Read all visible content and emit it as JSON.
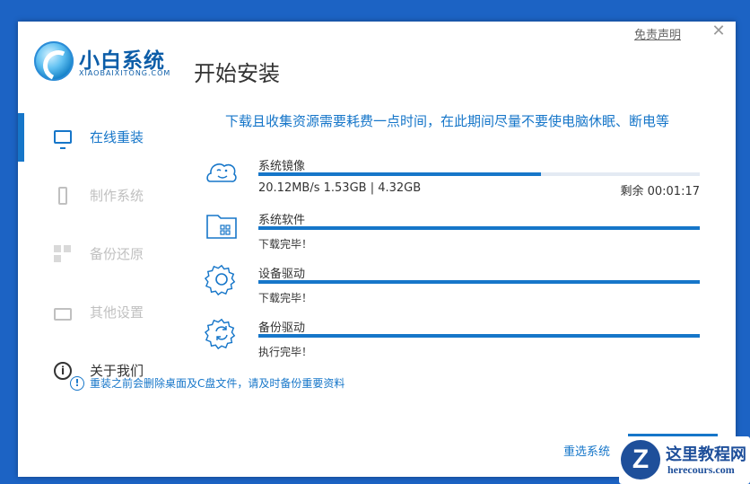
{
  "window": {
    "logo_title": "小白系统",
    "logo_subtitle": "XIAOBAIXITONG.COM",
    "page_title": "开始安装",
    "disclaimer_link": "免责声明",
    "close_glyph": "✕"
  },
  "sidebar": {
    "items": [
      {
        "label": "在线重装",
        "icon": "monitor-icon",
        "state": "active"
      },
      {
        "label": "制作系统",
        "icon": "usb-drive-icon",
        "state": "disabled"
      },
      {
        "label": "备份还原",
        "icon": "backup-icon",
        "state": "disabled"
      },
      {
        "label": "其他设置",
        "icon": "briefcase-icon",
        "state": "disabled"
      },
      {
        "label": "关于我们",
        "icon": "info-icon",
        "state": "normal"
      }
    ]
  },
  "main": {
    "headline": "下载且收集资源需要耗费一点时间，在此期间尽量不要使电脑休眠、断电等",
    "tasks": [
      {
        "name": "系统镜像",
        "icon": "cloud-face-icon",
        "progress": 0.64,
        "status": "20.12MB/s 1.53GB | 4.32GB",
        "remaining": "剩余 00:01:17"
      },
      {
        "name": "系统软件",
        "icon": "software-folder-icon",
        "progress": 1.0,
        "status": "下载完毕！"
      },
      {
        "name": "设备驱动",
        "icon": "gear-icon",
        "progress": 1.0,
        "status": "下载完毕！"
      },
      {
        "name": "备份驱动",
        "icon": "gear-refresh-icon",
        "progress": 1.0,
        "status": "执行完毕！"
      }
    ],
    "notice": "重装之前会删除桌面及C盘文件，请及时备份重要资料",
    "notice_icon_glyph": "!"
  },
  "footer": {
    "reselect_label": "重选系统"
  },
  "watermark": {
    "logo_letter": "Z",
    "title": "这里教程网",
    "url": "herecours.com"
  },
  "colors": {
    "accent": "#1676c9",
    "background": "#1c63c4",
    "disabled_text": "#c0c0c0"
  }
}
